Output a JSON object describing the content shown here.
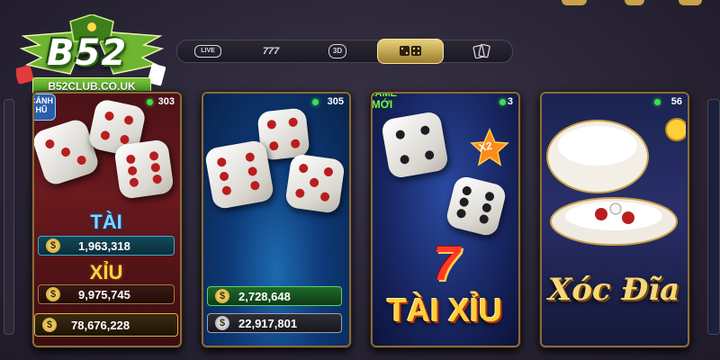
{
  "logo": {
    "name": "B52",
    "url": "B52CLUB.CO.UK"
  },
  "tabs": [
    {
      "label": "LIVE",
      "icon": "live-icon"
    },
    {
      "label": "777",
      "icon": "slot-icon"
    },
    {
      "label": "3D",
      "icon": "3d-icon"
    },
    {
      "label": "",
      "icon": "dice-icon",
      "active": true
    },
    {
      "label": "",
      "icon": "cards-icon"
    }
  ],
  "cards": [
    {
      "id": "tai-xiu-hu",
      "badge": "HŨ",
      "badge_prefix": "CÁNH",
      "count": "303",
      "tai_label": "TÀI",
      "xiu_label": "XỈU",
      "tai_value": "1,963,318",
      "xiu_value": "9,975,745",
      "jackpot_value": "78,676,228",
      "currency": "$"
    },
    {
      "id": "tai-xiu-3d",
      "count": "305",
      "value_1": "2,728,648",
      "value_2": "22,917,801",
      "currency": "$"
    },
    {
      "id": "tai-xiu-moi",
      "badge_line1": "GAME",
      "badge_line2": "MỚI",
      "count": "3",
      "multiplier": "X2",
      "seven": "7",
      "title": "TÀI XỈU"
    },
    {
      "id": "xoc-dia",
      "count": "56",
      "title": "Xóc Đĩa"
    }
  ],
  "colors": {
    "accent_gold": "#c9a24a",
    "green": "#3ee04d",
    "live_red": "#d9332b"
  }
}
